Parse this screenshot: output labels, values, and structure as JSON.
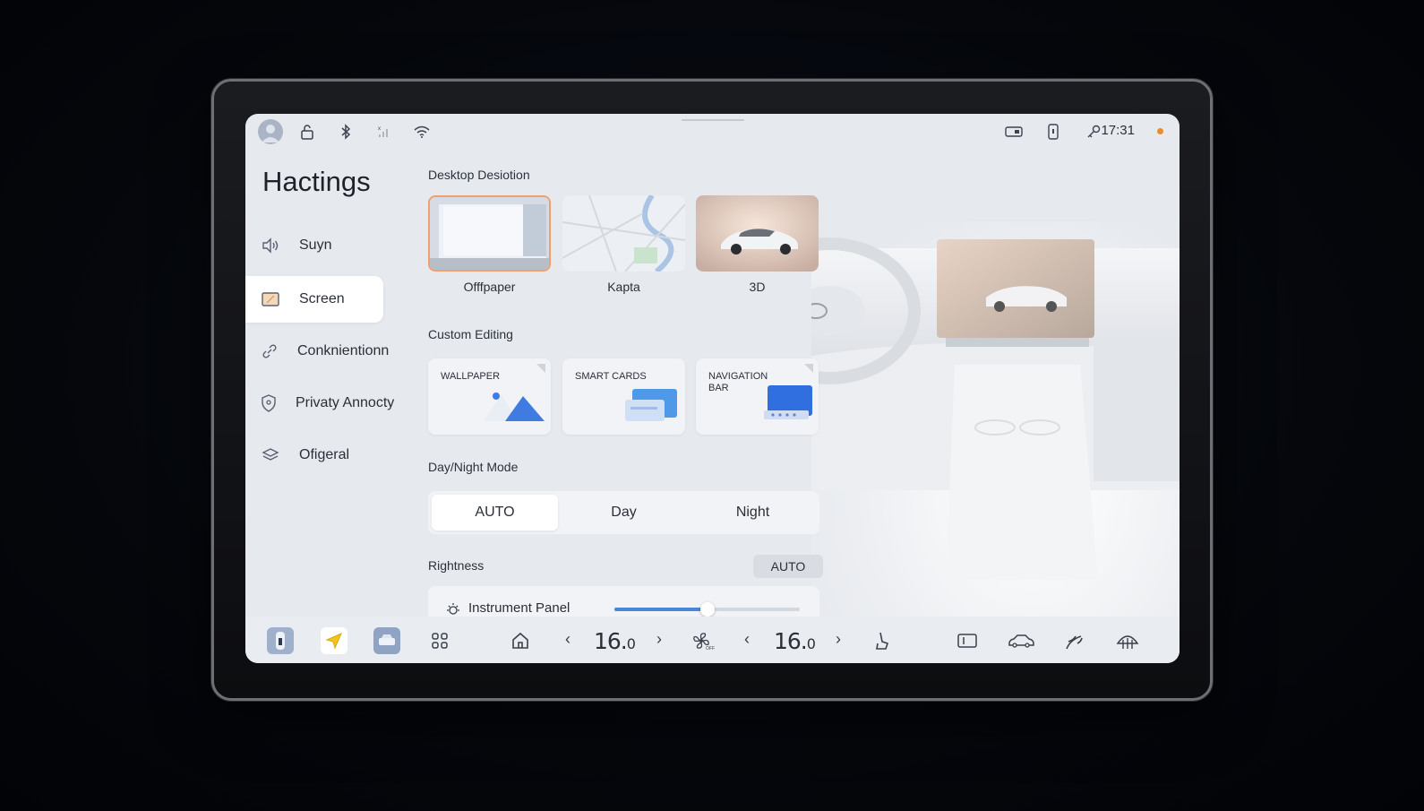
{
  "status_bar": {
    "time": "17:31",
    "icons": [
      "avatar-icon",
      "unlock-icon",
      "bluetooth-icon",
      "signal-icon",
      "wifi-icon",
      "dashcam-icon",
      "phone-key-icon",
      "key-icon",
      "notification-dot"
    ]
  },
  "sidebar": {
    "title": "Hactings",
    "items": [
      {
        "label": "Suyn",
        "icon": "speaker-icon",
        "active": false
      },
      {
        "label": "Screen",
        "icon": "screen-icon",
        "active": true
      },
      {
        "label": "Conknientionn",
        "icon": "link-icon",
        "active": false
      },
      {
        "label": "Privaty Annocty",
        "icon": "shield-icon",
        "active": false
      },
      {
        "label": "Ofigeral",
        "icon": "layers-icon",
        "active": false
      }
    ]
  },
  "desktop": {
    "heading": "Desktop Desiotion",
    "options": [
      {
        "label": "Offfpaper",
        "selected": true
      },
      {
        "label": "Kapta",
        "selected": false
      },
      {
        "label": "3D",
        "selected": false
      }
    ]
  },
  "custom_editing": {
    "heading": "Custom Editing",
    "cards": [
      {
        "label": "WALLPAPER"
      },
      {
        "label": "SMART CARDS"
      },
      {
        "label": "NAVIGATION BAR"
      }
    ]
  },
  "day_night": {
    "heading": "Day/Night Mode",
    "options": [
      "AUTO",
      "Day",
      "Night"
    ],
    "selected": "AUTO"
  },
  "brightness": {
    "heading": "Rightness",
    "auto_label": "AUTO",
    "instrument_panel_label": "Instrument Panel",
    "instrument_panel_level": 0.5
  },
  "dock": {
    "left_temp": "16.",
    "left_temp_decimal": "0",
    "right_temp": "16.",
    "right_temp_decimal": "0",
    "fan_state": "OFF"
  },
  "colors": {
    "accent": "#4a86d8",
    "selected_border": "#f0a070",
    "notification": "#f08a24"
  }
}
